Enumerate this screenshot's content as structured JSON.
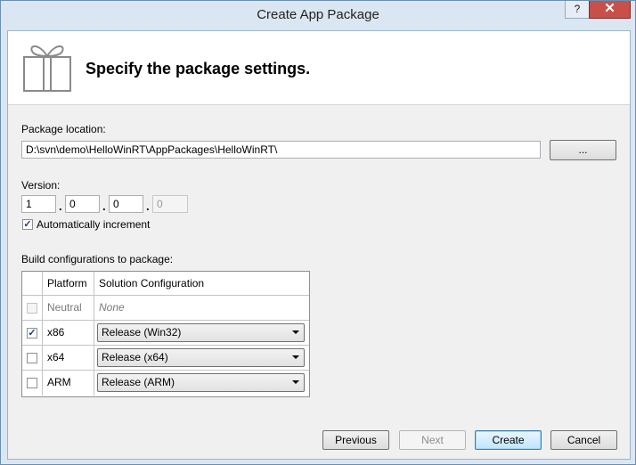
{
  "window": {
    "title": "Create App Package",
    "help_label": "?",
    "close_label": "✕"
  },
  "header": {
    "title": "Specify the package settings.",
    "icon": "gift-package-icon"
  },
  "location": {
    "label": "Package location:",
    "value": "D:\\svn\\demo\\HelloWinRT\\AppPackages\\HelloWinRT\\",
    "browse_label": "..."
  },
  "version": {
    "label": "Version:",
    "major": "1",
    "minor": "0",
    "build": "0",
    "revision": "0",
    "separator": "."
  },
  "auto_increment": {
    "label": "Automatically increment",
    "checked": true
  },
  "build_configs": {
    "label": "Build configurations to package:",
    "columns": [
      "Platform",
      "Solution Configuration"
    ],
    "rows": [
      {
        "platform": "Neutral",
        "configuration": "None",
        "checked": false,
        "enabled": false
      },
      {
        "platform": "x86",
        "configuration": "Release (Win32)",
        "checked": true,
        "enabled": true
      },
      {
        "platform": "x64",
        "configuration": "Release (x64)",
        "checked": false,
        "enabled": true
      },
      {
        "platform": "ARM",
        "configuration": "Release (ARM)",
        "checked": false,
        "enabled": true
      }
    ]
  },
  "buttons": {
    "previous": "Previous",
    "next": "Next",
    "create": "Create",
    "cancel": "Cancel"
  },
  "colors": {
    "frame": "#dbe6f3",
    "close": "#c7504a",
    "default_button": "#bee6fd"
  }
}
